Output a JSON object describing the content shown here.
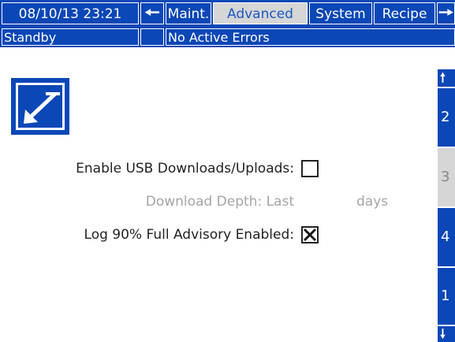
{
  "header": {
    "datetime": "08/10/13 23:21",
    "back_icon": "left-arrow-icon",
    "tabs": [
      {
        "label": "Maint.",
        "active": false
      },
      {
        "label": "Advanced",
        "active": true
      },
      {
        "label": "System",
        "active": false
      },
      {
        "label": "Recipe",
        "active": false
      }
    ],
    "forward_icon": "right-arrow-icon"
  },
  "status": {
    "mode": "Standby",
    "indicator": "",
    "errors": "No Active Errors"
  },
  "screen_icon": "edit-setup-icon",
  "settings": {
    "usb_label": "Enable USB Downloads/Uploads:",
    "usb_checked": false,
    "depth_label": "Download Depth: Last",
    "depth_value": "",
    "depth_unit": "days",
    "log_label": "Log 90% Full Advisory Enabled:",
    "log_checked": true
  },
  "pager": {
    "up_icon": "up-arrow-icon",
    "pages": [
      "2",
      "3",
      "4",
      "1"
    ],
    "active_page": "3",
    "down_icon": "down-arrow-icon"
  },
  "colors": {
    "accent": "#0b47b6",
    "active_tab": "#d6d6d6",
    "disabled_text": "#a5a5a5"
  }
}
